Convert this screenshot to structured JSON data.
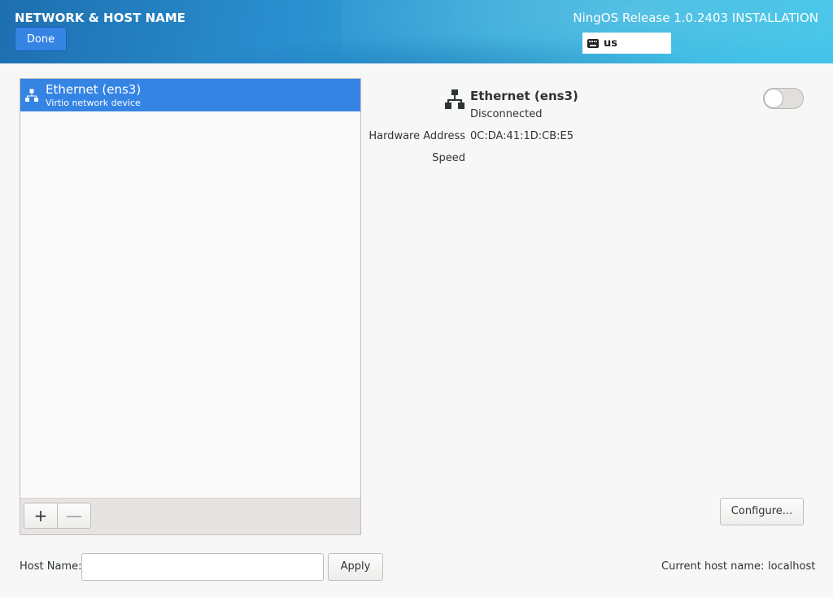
{
  "header": {
    "page_title": "NETWORK & HOST NAME",
    "done_label": "Done",
    "install_title": "NingOS Release 1.0.2403 INSTALLATION",
    "keyboard_layout": "us"
  },
  "device_list": {
    "items": [
      {
        "name": "Ethernet (ens3)",
        "description": "Virtio network device",
        "selected": true
      }
    ],
    "add_label": "+",
    "remove_label": "—"
  },
  "details": {
    "name": "Ethernet (ens3)",
    "status": "Disconnected",
    "enabled": false,
    "properties": [
      {
        "label": "Hardware Address",
        "value": "0C:DA:41:1D:CB:E5"
      },
      {
        "label": "Speed",
        "value": ""
      }
    ],
    "configure_label": "Configure..."
  },
  "hostname": {
    "label": "Host Name:",
    "value": "",
    "placeholder": "",
    "apply_label": "Apply",
    "current_label": "Current host name:",
    "current_value": "localhost"
  },
  "colors": {
    "header_gradient_start": "#1d6fb0",
    "header_gradient_end": "#3bc2e8",
    "selection": "#3584e4",
    "done_button": "#3584e4"
  }
}
